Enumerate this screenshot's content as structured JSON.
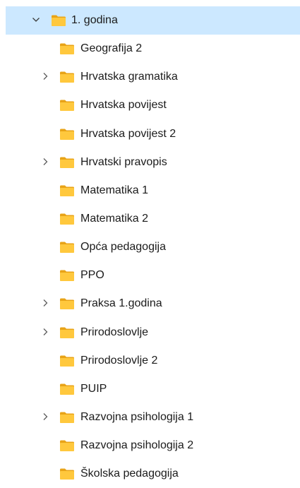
{
  "colors": {
    "selection": "#cce8ff",
    "folder_body": "#ffc83d",
    "folder_tab": "#e8a317",
    "chevron": "#5c5c5c"
  },
  "root": {
    "label": "1. godina",
    "icon": "folder-icon",
    "expanded": true,
    "selected": true
  },
  "children": [
    {
      "label": "Geografija 2",
      "has_children": false
    },
    {
      "label": "Hrvatska gramatika",
      "has_children": true
    },
    {
      "label": "Hrvatska povijest",
      "has_children": false
    },
    {
      "label": "Hrvatska povijest 2",
      "has_children": false
    },
    {
      "label": "Hrvatski pravopis",
      "has_children": true
    },
    {
      "label": "Matematika 1",
      "has_children": false
    },
    {
      "label": "Matematika 2",
      "has_children": false
    },
    {
      "label": "Opća pedagogija",
      "has_children": false
    },
    {
      "label": "PPO",
      "has_children": false
    },
    {
      "label": "Praksa 1.godina",
      "has_children": true
    },
    {
      "label": "Prirodoslovlje",
      "has_children": true
    },
    {
      "label": "Prirodoslovlje 2",
      "has_children": false
    },
    {
      "label": "PUIP",
      "has_children": false
    },
    {
      "label": "Razvojna psihologija 1",
      "has_children": true
    },
    {
      "label": "Razvojna psihologija 2",
      "has_children": false
    },
    {
      "label": "Školska pedagogija",
      "has_children": false
    }
  ]
}
